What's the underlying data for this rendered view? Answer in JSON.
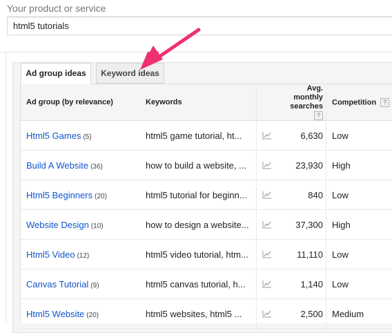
{
  "product_field": {
    "label": "Your product or service",
    "value": "html5 tutorials"
  },
  "tabs": [
    {
      "label": "Ad group ideas",
      "active": true
    },
    {
      "label": "Keyword ideas",
      "active": false
    }
  ],
  "table": {
    "headers": {
      "ad_group": "Ad group (by relevance)",
      "keywords": "Keywords",
      "avg_line1": "Avg. monthly",
      "avg_line2": "searches",
      "competition": "Competition",
      "help": "?"
    },
    "rows": [
      {
        "group": "Html5 Games",
        "count": "(5)",
        "keywords": "html5 game tutorial, ht...",
        "searches": "6,630",
        "competition": "Low"
      },
      {
        "group": "Build A Website",
        "count": "(36)",
        "keywords": "how to build a website, ...",
        "searches": "23,930",
        "competition": "High"
      },
      {
        "group": "Html5 Beginners",
        "count": "(20)",
        "keywords": "html5 tutorial for beginn...",
        "searches": "840",
        "competition": "Low"
      },
      {
        "group": "Website Design",
        "count": "(10)",
        "keywords": "how to design a website...",
        "searches": "37,300",
        "competition": "High"
      },
      {
        "group": "Html5 Video",
        "count": "(12)",
        "keywords": "html5 video tutorial, htm...",
        "searches": "11,110",
        "competition": "Low"
      },
      {
        "group": "Canvas Tutorial",
        "count": "(9)",
        "keywords": "html5 canvas tutorial, h...",
        "searches": "1,140",
        "competition": "Low"
      },
      {
        "group": "Html5 Website",
        "count": "(20)",
        "keywords": "html5 websites, html5 ...",
        "searches": "2,500",
        "competition": "Medium"
      }
    ]
  },
  "icons": {
    "trend": "trend-chart-icon",
    "annotation": "pink-arrow"
  },
  "colors": {
    "link": "#1155cc",
    "annotation_arrow": "#f0306e"
  }
}
